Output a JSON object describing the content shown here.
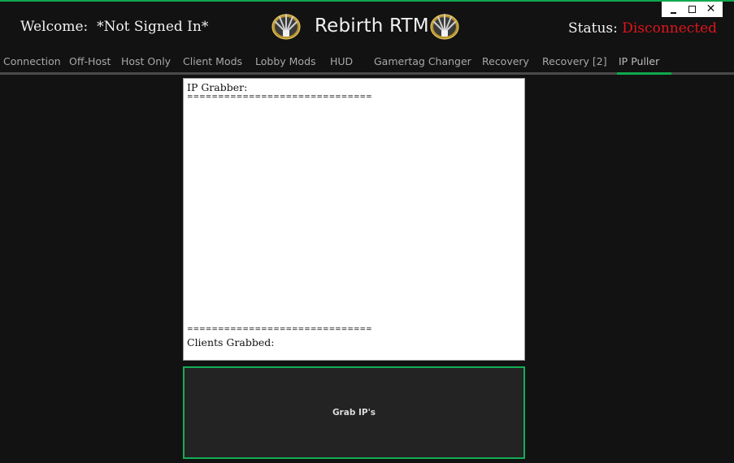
{
  "window": {
    "title": "Rebirth RTM",
    "accent_color": "#0fa84e",
    "controls": {
      "minimize_icon": "minimize-icon",
      "maximize_icon": "maximize-icon",
      "close_glyph": "✕"
    }
  },
  "header": {
    "welcome_label": "Welcome:",
    "welcome_user": "*Not Signed In*",
    "title": "Rebirth RTM",
    "logo_icon": "rebirth-emblem-icon",
    "status_label": "Status:",
    "status_value": "Disconnected",
    "status_color": "#e0141b"
  },
  "tabs": [
    {
      "label": "Connection",
      "active": false
    },
    {
      "label": "Off-Host",
      "active": false
    },
    {
      "label": "Host Only",
      "active": false
    },
    {
      "label": "Client Mods",
      "active": false
    },
    {
      "label": "Lobby Mods",
      "active": false
    },
    {
      "label": "HUD",
      "active": false
    },
    {
      "label": "Gamertag Changer",
      "active": false
    },
    {
      "label": "Recovery",
      "active": false
    },
    {
      "label": "Recovery [2]",
      "active": false
    },
    {
      "label": "IP Puller",
      "active": true
    }
  ],
  "ip_puller": {
    "output": {
      "heading": "IP Grabber:",
      "separator_top": "==============================",
      "separator_bottom": "==============================",
      "footer": "Clients Grabbed:"
    },
    "grab_button_label": "Grab IP's"
  }
}
